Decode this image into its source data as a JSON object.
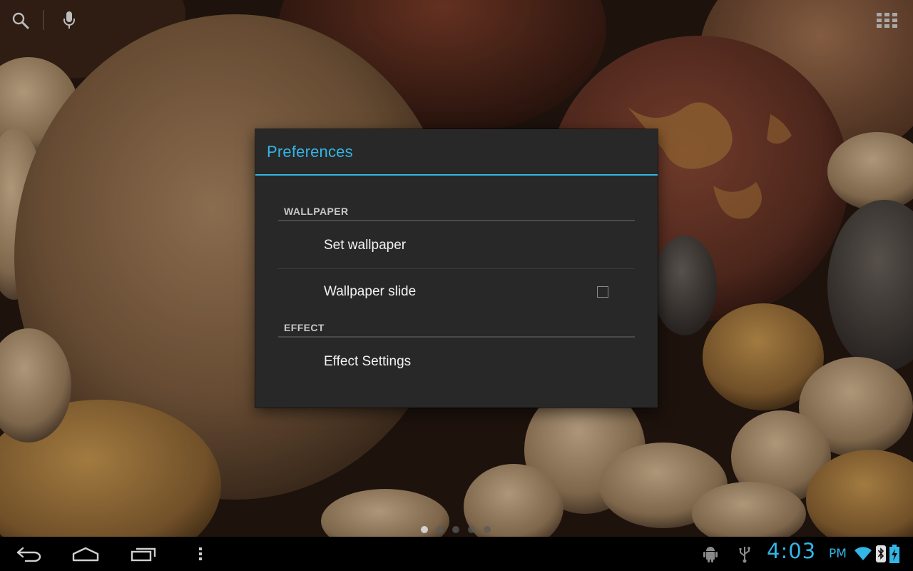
{
  "dialog": {
    "title": "Preferences",
    "sections": [
      {
        "header": "WALLPAPER",
        "items": [
          {
            "label": "Set wallpaper"
          },
          {
            "label": "Wallpaper slide",
            "checkbox": {
              "checked": false
            }
          }
        ]
      },
      {
        "header": "EFFECT",
        "items": [
          {
            "label": "Effect Settings"
          }
        ]
      }
    ]
  },
  "status_bar": {
    "time": "4:03",
    "ampm": "PM"
  },
  "page_indicator": {
    "count": 5,
    "active_index": 0
  },
  "icons": {
    "top_bar": [
      "search-icon",
      "mic-icon",
      "apps-grid-icon"
    ],
    "nav": [
      "back-icon",
      "home-icon",
      "recent-apps-icon",
      "menu-overflow-icon"
    ],
    "status": [
      "android-debug-icon",
      "usb-icon",
      "wifi-icon",
      "bluetooth-icon",
      "battery-charging-icon"
    ]
  },
  "colors": {
    "accent": "#33b5e5",
    "dialog_bg": "#282828",
    "text_primary": "#f2f2f2",
    "section_header": "#c8c8c8"
  }
}
